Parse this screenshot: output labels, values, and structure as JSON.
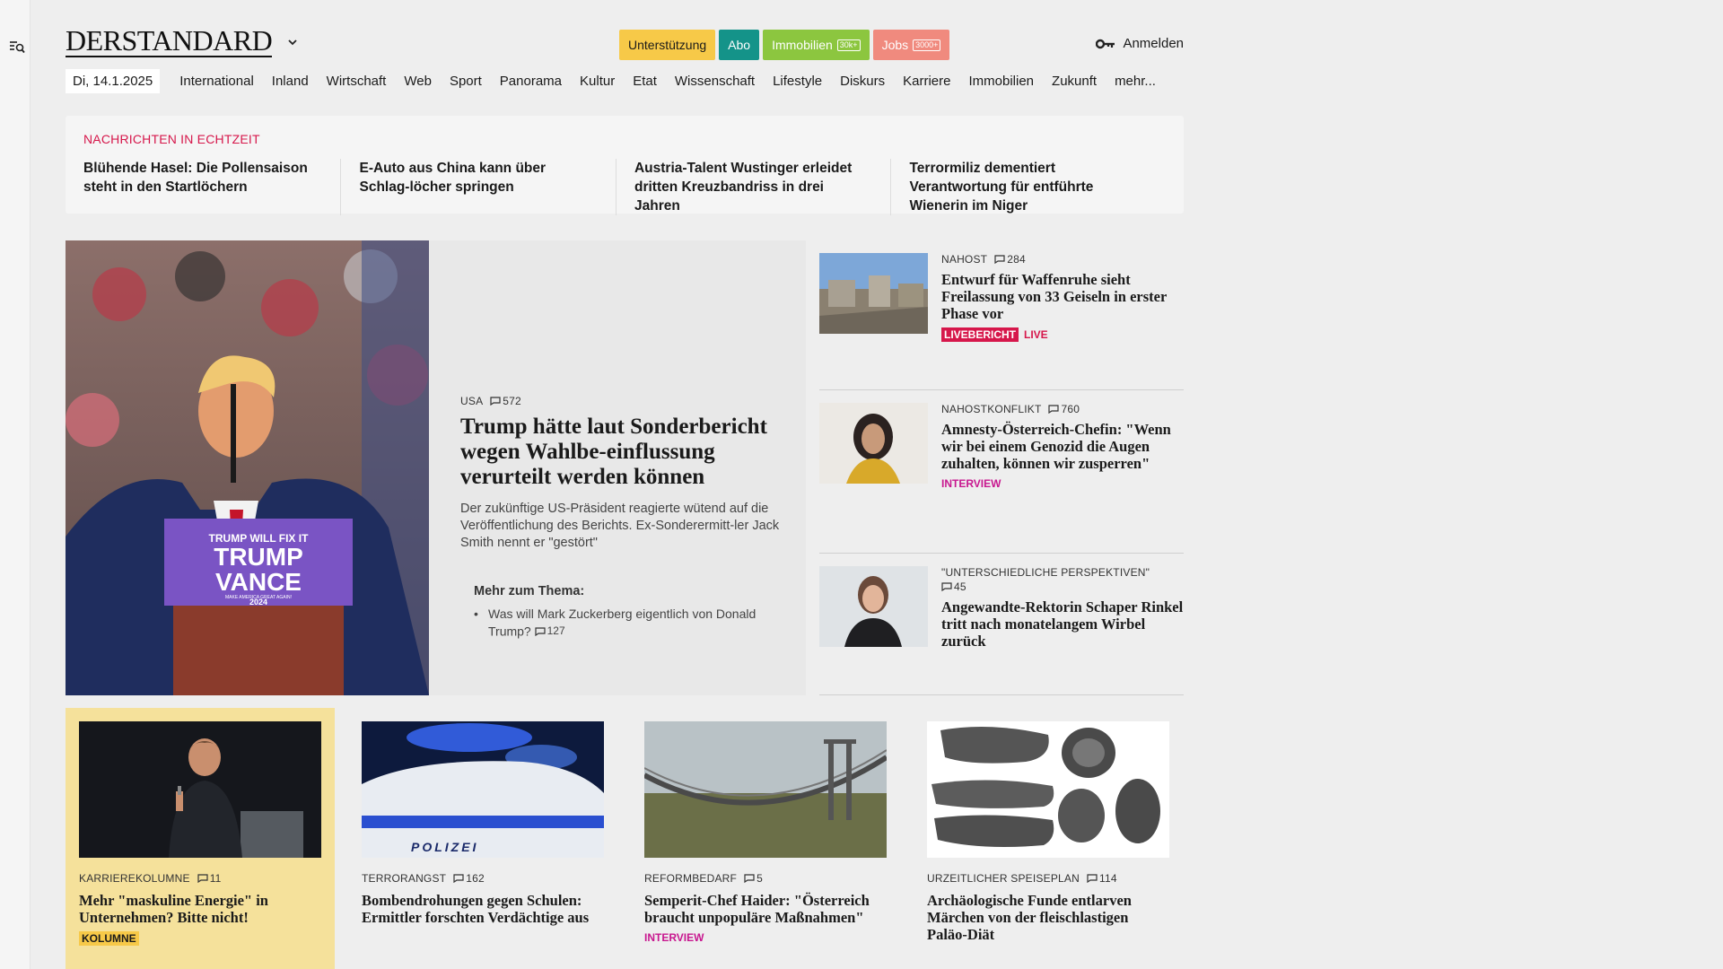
{
  "header": {
    "logo": "DERSTANDARD",
    "pills": [
      {
        "label": "Unterstützung",
        "count": ""
      },
      {
        "label": "Abo",
        "count": ""
      },
      {
        "label": "Immobilien",
        "count": "30k+"
      },
      {
        "label": "Jobs",
        "count": "3000+"
      }
    ],
    "login": "Anmelden"
  },
  "nav": {
    "date": "Di, 14.1.2025",
    "items": [
      "International",
      "Inland",
      "Wirtschaft",
      "Web",
      "Sport",
      "Panorama",
      "Kultur",
      "Etat",
      "Wissenschaft",
      "Lifestyle",
      "Diskurs",
      "Karriere",
      "Immobilien",
      "Zukunft",
      "mehr..."
    ]
  },
  "ticker": {
    "heading": "NACHRICHTEN IN ECHTZEIT",
    "items": [
      "Blühende Hasel: Die Pollensaison steht in den Startlöchern",
      "E-Auto aus China kann über Schlag-löcher springen",
      "Austria-Talent Wustinger erleidet dritten Kreuzbandriss in drei Jahren",
      "Terrormiliz dementiert Verantwortung für entführte Wienerin im Niger"
    ]
  },
  "lead": {
    "kicker": "USA",
    "comments": "572",
    "title": "Trump hätte laut Sonderbericht wegen Wahlbe-einflussung verurteilt werden können",
    "teaser": "Der zukünftige US-Präsident reagierte wütend auf die Veröffentlichung des Berichts. Ex-Sonderermitt-ler Jack Smith nennt er \"gestört\"",
    "image_sign": {
      "top": "TRUMP WILL FIX IT",
      "line1": "TRUMP",
      "line2": "VANCE",
      "sub": "MAKE AMERICA GREAT AGAIN!",
      "year": "2024"
    },
    "more_heading": "Mehr zum Thema:",
    "more_items": [
      {
        "text": "Was will Mark Zuckerberg eigentlich von Donald Trump?",
        "comments": "127"
      }
    ]
  },
  "side": [
    {
      "kicker": "NAHOST",
      "comments": "284",
      "title": "Entwurf für Waffenruhe sieht Freilassung von 33 Geiseln in erster Phase vor",
      "tag": "LIVEBERICHT",
      "tag2": "LIVE"
    },
    {
      "kicker": "NAHOSTKONFLIKT",
      "comments": "760",
      "title": "Amnesty-Österreich-Chefin: \"Wenn wir bei einem Genozid die Augen zuhalten, können wir zusperren\"",
      "tag": "INTERVIEW"
    },
    {
      "kicker": "\"UNTERSCHIEDLICHE PERSPEKTIVEN\"",
      "comments": "45",
      "title": "Angewandte-Rektorin Schaper Rinkel tritt nach monatelangem Wirbel zurück"
    }
  ],
  "bottom": [
    {
      "kicker": "KARRIEREKOLUMNE",
      "comments": "11",
      "title": "Mehr \"maskuline Energie\" in Unternehmen? Bitte nicht!",
      "tag": "KOLUMNE"
    },
    {
      "kicker": "TERRORANGST",
      "comments": "162",
      "title": "Bombendrohungen gegen Schulen: Ermittler forschten Verdächtige aus",
      "image_text": "POLIZEI"
    },
    {
      "kicker": "REFORMBEDARF",
      "comments": "5",
      "title": "Semperit-Chef Haider: \"Österreich braucht unpopuläre Maßnahmen\"",
      "tag": "INTERVIEW"
    },
    {
      "kicker": "URZEITLICHER SPEISEPLAN",
      "comments": "114",
      "title": "Archäologische Funde entlarven Märchen von der fleischlastigen Paläo-Diät"
    }
  ],
  "colors": {
    "accent_red": "#d6174b",
    "interview": "#c8178f",
    "support": "#f7c948",
    "abo": "#149389",
    "immo": "#8cc63f",
    "jobs": "#f08a7e"
  }
}
